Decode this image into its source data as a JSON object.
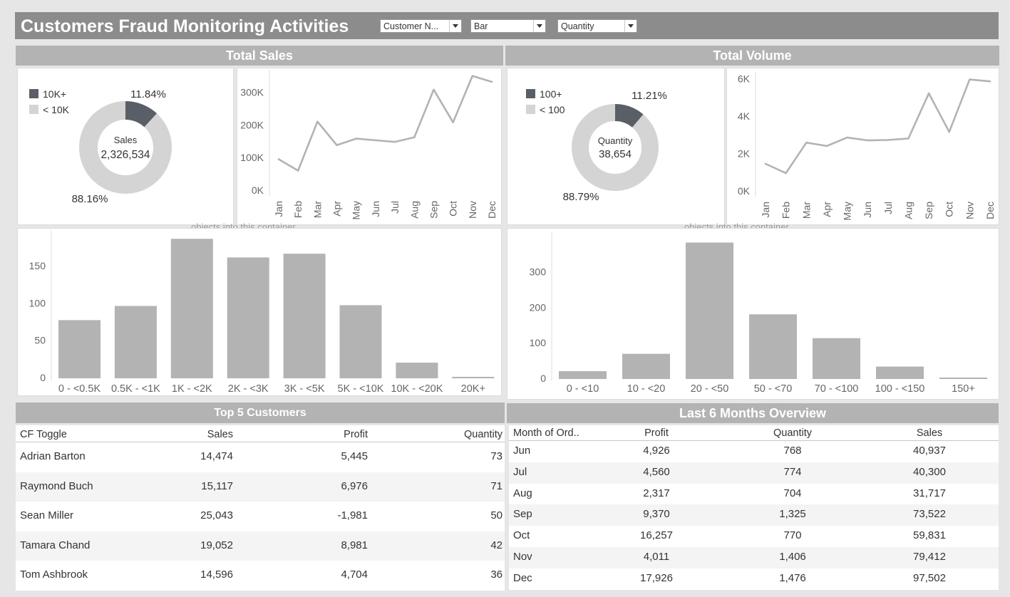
{
  "header": {
    "title": "Customers Fraud Monitoring Activities",
    "filters": [
      {
        "value": "Customer N..."
      },
      {
        "value": "Bar"
      },
      {
        "value": "Quantity"
      }
    ]
  },
  "sales": {
    "section_title": "Total Sales",
    "donut": {
      "legend": [
        "10K+",
        "< 10K"
      ],
      "colors": {
        "high": "#5a5e66",
        "low": "#d4d4d4"
      },
      "center_label": "Sales",
      "center_value": "2,326,534",
      "high_pct_label": "11.84%",
      "low_pct_label": "88.16%"
    },
    "watermark": "objects into this container"
  },
  "volume": {
    "section_title": "Total Volume",
    "donut": {
      "legend": [
        "100+",
        "< 100"
      ],
      "colors": {
        "high": "#5a5e66",
        "low": "#d4d4d4"
      },
      "center_label": "Quantity",
      "center_value": "38,654",
      "high_pct_label": "11.21%",
      "low_pct_label": "88.79%"
    },
    "watermark": "objects into this container"
  },
  "chart_data": [
    {
      "type": "pie",
      "categories": [
        "10K+",
        "< 10K"
      ],
      "values": [
        11.84,
        88.16
      ]
    },
    {
      "type": "line",
      "categories": [
        "Jan",
        "Feb",
        "Mar",
        "Apr",
        "May",
        "Jun",
        "Jul",
        "Aug",
        "Sep",
        "Oct",
        "Nov",
        "Dec"
      ],
      "values": [
        95000,
        60000,
        210000,
        138000,
        158000,
        153000,
        148000,
        162000,
        308000,
        208000,
        350000,
        332000
      ],
      "yticks": [
        "0K",
        "100K",
        "200K",
        "300K"
      ],
      "ylim": [
        0,
        360000
      ],
      "grid": false
    },
    {
      "type": "bar",
      "categories": [
        "0 - <0.5K",
        "0.5K - <1K",
        "1K - <2K",
        "2K - <3K",
        "3K - <5K",
        "5K - <10K",
        "10K - <20K",
        "20K+"
      ],
      "values": [
        77,
        96,
        186,
        161,
        166,
        97,
        20,
        1
      ],
      "yticks": [
        "0",
        "50",
        "100",
        "150"
      ],
      "ylim": [
        0,
        190
      ],
      "grid": false
    },
    {
      "type": "pie",
      "categories": [
        "100+",
        "< 100"
      ],
      "values": [
        11.21,
        88.79
      ]
    },
    {
      "type": "line",
      "categories": [
        "Jan",
        "Feb",
        "Mar",
        "Apr",
        "May",
        "Jun",
        "Jul",
        "Aug",
        "Sep",
        "Oct",
        "Nov",
        "Dec"
      ],
      "values": [
        1450,
        950,
        2580,
        2400,
        2850,
        2700,
        2720,
        2800,
        5210,
        3150,
        5950,
        5850
      ],
      "yticks": [
        "0K",
        "2K",
        "4K",
        "6K"
      ],
      "ylim": [
        0,
        6200
      ],
      "grid": false
    },
    {
      "type": "bar",
      "categories": [
        "0 - <10",
        "10 - <20",
        "20 - <50",
        "50 - <70",
        "70 - <100",
        "100 - <150",
        "150+"
      ],
      "values": [
        20,
        69,
        382,
        180,
        113,
        33,
        2
      ],
      "yticks": [
        "0",
        "100",
        "200",
        "300"
      ],
      "ylim": [
        0,
        395
      ],
      "grid": false
    }
  ],
  "top5": {
    "title": "Top 5 Customers",
    "columns": [
      "CF Toggle",
      "Sales",
      "Profit",
      "Quantity"
    ],
    "rows": [
      [
        "Adrian Barton",
        "14,474",
        "5,445",
        "73"
      ],
      [
        "Raymond Buch",
        "15,117",
        "6,976",
        "71"
      ],
      [
        "Sean Miller",
        "25,043",
        "-1,981",
        "50"
      ],
      [
        "Tamara Chand",
        "19,052",
        "8,981",
        "42"
      ],
      [
        "Tom Ashbrook",
        "14,596",
        "4,704",
        "36"
      ]
    ]
  },
  "last6": {
    "title": "Last 6 Months Overview",
    "columns": [
      "Month of Ord..",
      "Profit",
      "Quantity",
      "Sales"
    ],
    "rows": [
      [
        "Jun",
        "4,926",
        "768",
        "40,937"
      ],
      [
        "Jul",
        "4,560",
        "774",
        "40,300"
      ],
      [
        "Aug",
        "2,317",
        "704",
        "31,717"
      ],
      [
        "Sep",
        "9,370",
        "1,325",
        "73,522"
      ],
      [
        "Oct",
        "16,257",
        "770",
        "59,831"
      ],
      [
        "Nov",
        "4,011",
        "1,406",
        "79,412"
      ],
      [
        "Dec",
        "17,926",
        "1,476",
        "97,502"
      ]
    ]
  }
}
